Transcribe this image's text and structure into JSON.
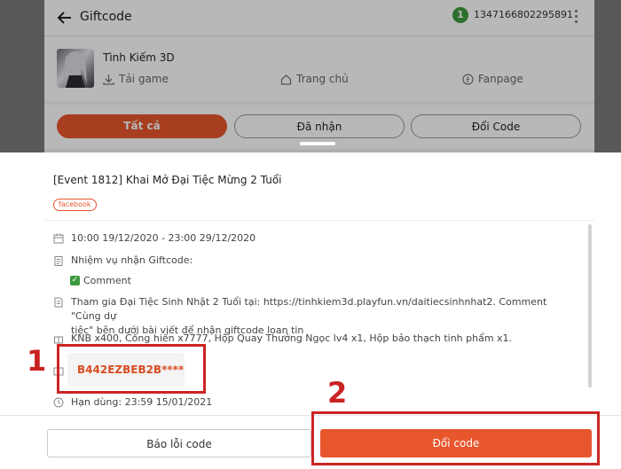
{
  "colors": {
    "accent": "#e8562d",
    "annotation": "#cc2424",
    "badge": "#3c9a3f"
  },
  "header": {
    "title": "Giftcode",
    "badge_count": "1",
    "user_id": "1347166802295891"
  },
  "game": {
    "name": "Tình Kiếm 3D",
    "links": [
      "Tải game",
      "Trang chủ",
      "Fanpage"
    ]
  },
  "tabs": [
    "Tất cả",
    "Đã nhận",
    "Đổi Code"
  ],
  "event": {
    "title": "[Event 1812] Khai Mở Đại Tiệc Mừng 2 Tuổi",
    "tag": "facebook",
    "time": "10:00 19/12/2020 - 23:00 29/12/2020",
    "mission_label": "Nhiệm vụ nhận Giftcode:",
    "mission_item": "Comment",
    "description_line1": "Tham gia Đại Tiệc Sinh Nhật 2 Tuổi tại: https://tinhkiem3d.playfun.vn/daitiecsinhnhat2. Comment \"Cùng dự",
    "description_line2": "tiệc\" bên dưới bài viết để nhận giftcode loan tin",
    "rewards": "KNB x400, Cống hiến x7777, Hộp Quay Thưởng Ngọc lv4 x1, Hộp bảo thạch tinh phẩm x1.",
    "code": "B442EZBEB2B****",
    "expiry": "Hạn dùng: 23:59 15/01/2021"
  },
  "annotations": {
    "one": "1",
    "two": "2"
  },
  "footer": {
    "report_label": "Báo lỗi code",
    "redeem_label": "Đổi code"
  },
  "icons": [
    "back-arrow-icon",
    "more-vertical-icon",
    "download-icon",
    "home-icon",
    "facebook-icon",
    "calendar-icon",
    "clipboard-icon",
    "document-icon",
    "gift-icon",
    "ticket-icon",
    "clock-icon",
    "check-icon"
  ]
}
